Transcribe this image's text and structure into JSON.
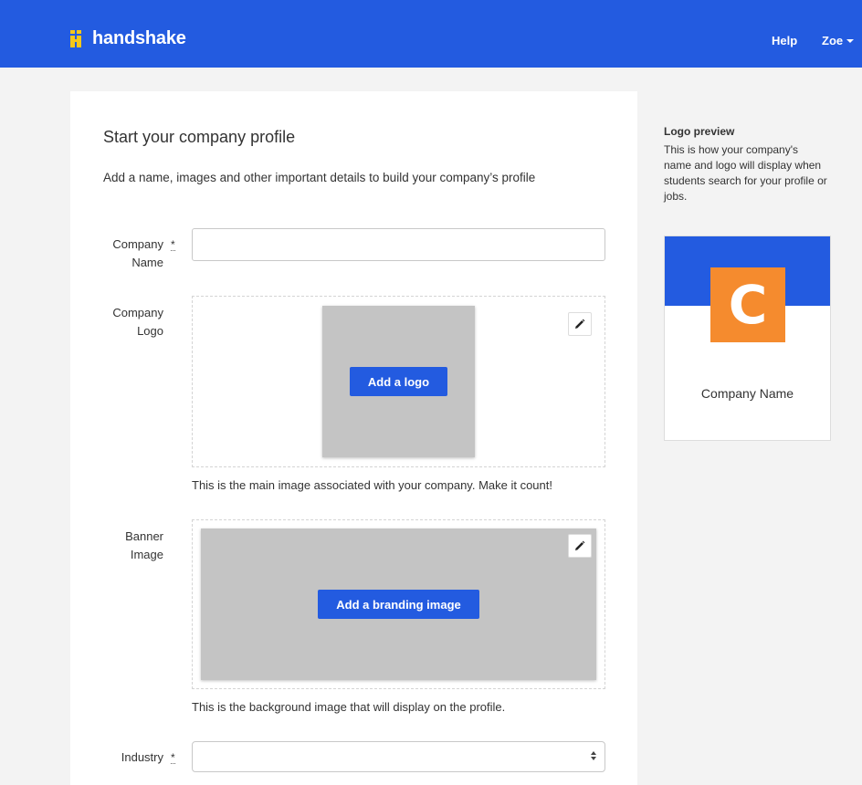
{
  "header": {
    "brand": "handshake",
    "help": "Help",
    "user": "Zoe",
    "colors": {
      "bar": "#235be0",
      "brand_mark": "#f5c71a"
    }
  },
  "form": {
    "title": "Start your company profile",
    "subtitle": "Add a name, images and other important details to build your company’s profile",
    "required_marker": "*",
    "company_name": {
      "label_line1": "Company",
      "label_line2": "Name",
      "value": ""
    },
    "company_logo": {
      "label_line1": "Company",
      "label_line2": "Logo",
      "button": "Add a logo",
      "helper": "This is the main image associated with your company. Make it count!"
    },
    "banner_image": {
      "label_line1": "Banner",
      "label_line2": "Image",
      "button": "Add a branding image",
      "helper": "This is the background image that will display on the profile."
    },
    "industry": {
      "label": "Industry",
      "selected": ""
    }
  },
  "preview": {
    "title": "Logo preview",
    "description": "This is how your company's name and logo will display when students search for your profile or jobs.",
    "logo_letter": "C",
    "company_name": "Company Name",
    "colors": {
      "banner": "#235be0",
      "logo": "#f58b2e"
    }
  }
}
